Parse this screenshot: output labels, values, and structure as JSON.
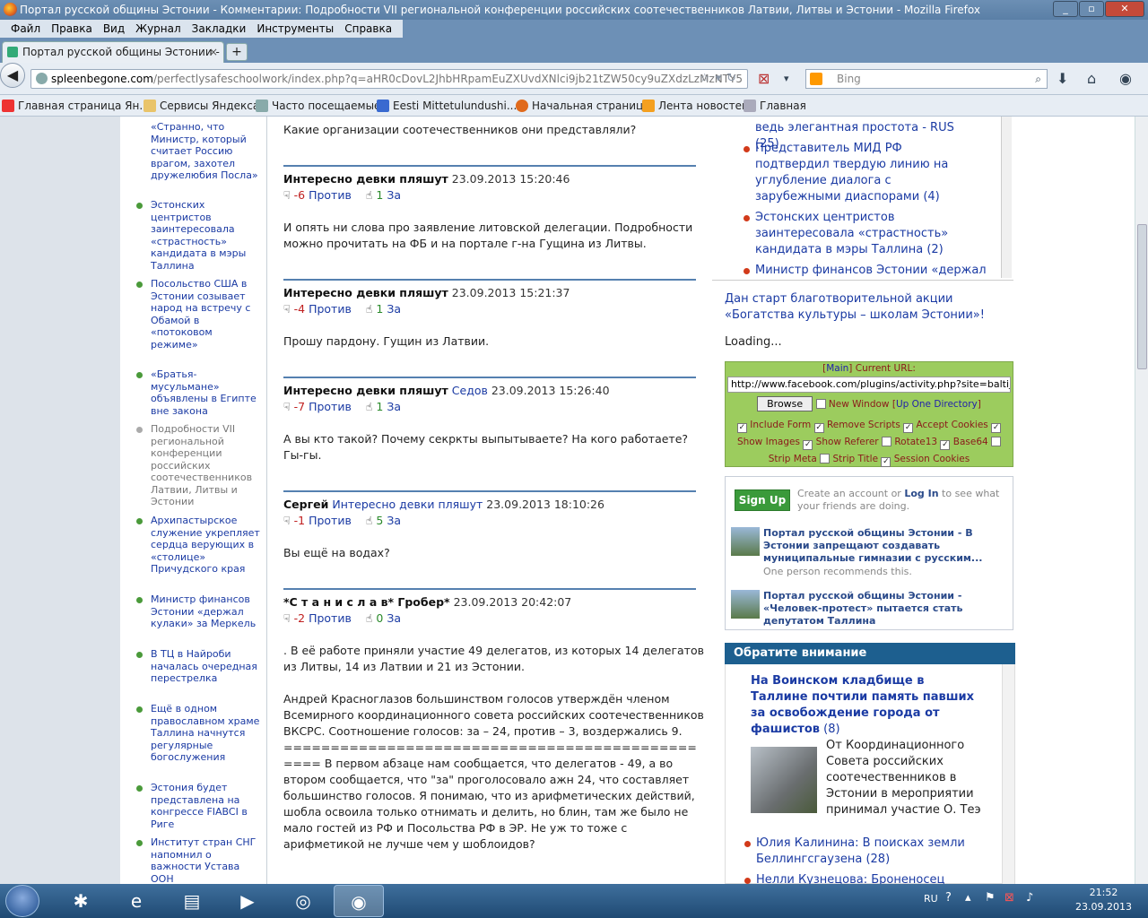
{
  "window": {
    "title": "Портал русской общины Эстонии - Комментарии: Подробности VII региональной конференции российских соотечественников Латвии, Литвы и Эстонии - Mozilla Firefox"
  },
  "menu": [
    "Файл",
    "Правка",
    "Вид",
    "Журнал",
    "Закладки",
    "Инструменты",
    "Справка"
  ],
  "tab": {
    "label": "Портал русской общины Эстонии - Ко..."
  },
  "nav": {
    "url_domain": "spleenbegone.com",
    "url_rest": "/perfectlysafeschoolwork/index.php?q=aHR0cDovL2JhbHRpamEuZXUvdXNlci9jb21tZW50cy9uZXdzLzMzNTY5",
    "search_engine": "Bing"
  },
  "bookmarks": [
    "Главная страница Ян...",
    "Сервисы Яндекса",
    "Часто посещаемые",
    "Eesti Mittetulundushi...",
    "Начальная страница",
    "Лента новостей",
    "Главная"
  ],
  "left_links": [
    {
      "text": "«Странно, что Министр, который считает Россию врагом, захотел дружелюбия Посла»",
      "visited": false
    },
    {
      "text": "Эстонских центристов заинтересовала «страстность» кандидата в мэры Таллина",
      "visited": false
    },
    {
      "text": "Посольство США в Эстонии созывает народ на встречу с Обамой в «потоковом режиме»",
      "visited": false
    },
    {
      "text": "«Братья-мусульмане» объявлены в Египте вне закона",
      "visited": false
    },
    {
      "text": "Подробности VII региональной конференции российских соотечественников Латвии, Литвы и Эстонии",
      "visited": true
    },
    {
      "text": "Архипастырское служение укрепляет сердца верующих в «столице» Причудского края",
      "visited": false
    },
    {
      "text": "Министр финансов Эстонии «держал кулаки» за Меркель",
      "visited": false
    },
    {
      "text": "В ТЦ в Найроби началась очередная перестрелка",
      "visited": false
    },
    {
      "text": "Ещё в одном православном храме Таллина начнутся регулярные богослужения",
      "visited": false
    },
    {
      "text": "Эстония будет представлена на конгрессе FIABCI в Риге",
      "visited": false
    },
    {
      "text": "Институт стран СНГ напомнил о важности Устава ООН",
      "visited": false
    }
  ],
  "intro_text": "Какие организации соотечественников они представляли?",
  "comments": [
    {
      "author": "Интересно девки пляшут",
      "reply_to": "",
      "date": "23.09.2013 15:20:46",
      "neg": "-6",
      "against": "Против",
      "pos": "1",
      "for": "За",
      "text": [
        "И опять ни слова про заявление литовской делегации. Подробности можно прочитать на ФБ и на портале г-на Гущина из Литвы."
      ]
    },
    {
      "author": "Интересно девки пляшут",
      "reply_to": "",
      "date": "23.09.2013 15:21:37",
      "neg": "-4",
      "against": "Против",
      "pos": "1",
      "for": "За",
      "text": [
        "Прошу пардону. Гущин из Латвии."
      ]
    },
    {
      "author": "Интересно девки пляшут",
      "reply_to": "Седов",
      "date": "23.09.2013 15:26:40",
      "neg": "-7",
      "against": "Против",
      "pos": "1",
      "for": "За",
      "text": [
        "А вы кто такой? Почему секркты выпытываете? На кого работаете? Гы-гы."
      ]
    },
    {
      "author": "Сергей",
      "reply_to": "Интересно девки пляшут",
      "date": "23.09.2013 18:10:26",
      "neg": "-1",
      "against": "Против",
      "pos": "5",
      "for": "За",
      "text": [
        "Вы ещё на водах?"
      ]
    },
    {
      "author": "*С т а н и с л а в* Гробер*",
      "reply_to": "",
      "date": "23.09.2013 20:42:07",
      "neg": "-2",
      "against": "Против",
      "pos": "0",
      "for": "За",
      "text": [
        ". В её работе приняли участие 49 делегатов, из которых 14 делегатов из Литвы, 14 из Латвии и 21 из Эстонии.",
        "Андрей Красноглазов большинством голосов утверждён членом Всемирного координационного совета российских соотечественников ВКСРС. Соотношение голосов: за – 24, против – 3, воздержались 9. ================================================ В первом абзаце нам сообщается, что делегатов - 49, а во втором сообщается, что \"за\" проголосовало ажн 24, что составляет большинство голосов. Я понимаю, что из арифметических действий, шобла освоила только отнимать и делить, но блин, там же было не мало гостей из РФ и Посольства РФ в ЭР. Не уж то тоже с арифметикой не лучше чем у шоблоидов?"
      ]
    }
  ],
  "right_links": [
    {
      "text": "ведь элегантная простота - RUS (25)"
    },
    {
      "text": "Представитель МИД РФ подтвердил твердую линию на углубление диалога с зарубежными диаспорами (4)"
    },
    {
      "text": "Эстонских центристов заинтересовала «страстность» кандидата в мэры Таллина (2)"
    },
    {
      "text": "Министр финансов Эстонии «держал"
    }
  ],
  "charity_link": "Дан старт благотворительной акции «Богатства культуры – школам Эстонии»!",
  "loading": "Loading...",
  "proxy": {
    "main": "Main",
    "current_url": "Current URL:",
    "url": "http://www.facebook.com/plugins/activity.php?site=baltija.eu&wi",
    "browse": "Browse",
    "new_window": "New Window",
    "up": "Up One Directory",
    "include_form": "Include Form",
    "remove_scripts": "Remove Scripts",
    "accept_cookies": "Accept Cookies",
    "show_images": "Show Images",
    "show_referer": "Show Referer",
    "rotate13": "Rotate13",
    "base64": "Base64",
    "strip_meta": "Strip Meta",
    "strip_title": "Strip Title",
    "session_cookies": "Session Cookies"
  },
  "facebook": {
    "signup": "Sign Up",
    "create_text": "Create an account or",
    "login": "Log In",
    "see_text": "to see what your friends are doing.",
    "items": [
      {
        "title": "Портал русской общины Эстонии - В Эстонии запрещают создавать муниципальные гимназии с русским...",
        "meta": "One person recommends this."
      },
      {
        "title": "Портал русской общины Эстонии - «Человек-протест» пытается стать депутатом Таллина",
        "meta": ""
      }
    ]
  },
  "attention": {
    "header": "Обратите внимание",
    "headline": "На Воинском кладбище в Таллине почтили память павших за освобождение города от фашистов",
    "count": "(8)",
    "body": "От Координационного Совета российских соотечественников в Эстонии в мероприятии принимал участие О. Теэ",
    "more": [
      {
        "text": "Юлия Калинина: В поисках земли Беллингсгаузена (28)"
      },
      {
        "text": "Нелли Кузнецова: Броненосец"
      }
    ]
  },
  "taskbar": {
    "lang": "RU",
    "time": "21:52",
    "date": "23.09.2013"
  }
}
